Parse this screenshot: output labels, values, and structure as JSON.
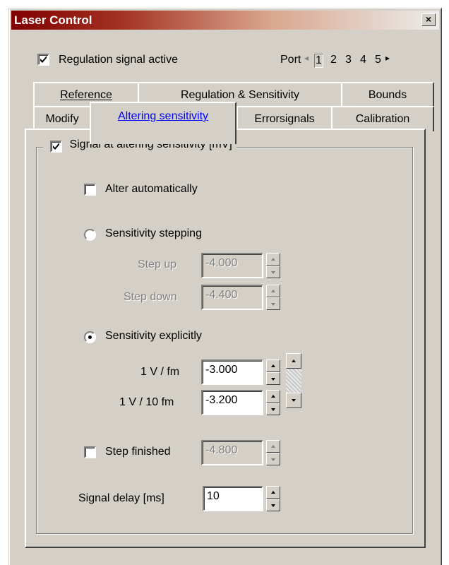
{
  "window": {
    "title": "Laser Control"
  },
  "header": {
    "regulation_label": "Regulation signal active",
    "regulation_checked": true,
    "port_label": "Port",
    "ports": [
      "1",
      "2",
      "3",
      "4",
      "5"
    ],
    "selected_port": "1"
  },
  "tabs": {
    "row_back": [
      "Reference",
      "Regulation & Sensitivity",
      "Bounds"
    ],
    "row_front": [
      "Modify",
      "Altering sensitivity",
      "Errorsignals",
      "Calibration"
    ],
    "active": "Altering sensitivity"
  },
  "group": {
    "legend": "Signal at altering sensitivity  [mV]",
    "checked": true,
    "alter_auto_label": "Alter automatically",
    "stepping_label": "Sensitivity stepping",
    "step_up_label": "Step up",
    "step_up_value": "-4.000",
    "step_down_label": "Step down",
    "step_down_value": "-4.400",
    "explicit_label": "Sensitivity explicitly",
    "fm_label": "1 V / fm",
    "fm_value": "-3.000",
    "tenfm_label": "1 V / 10 fm",
    "tenfm_value": "-3.200",
    "step_finished_label": "Step finished",
    "step_finished_value": "-4.800",
    "signal_delay_label": "Signal delay  [ms]",
    "signal_delay_value": "10"
  }
}
